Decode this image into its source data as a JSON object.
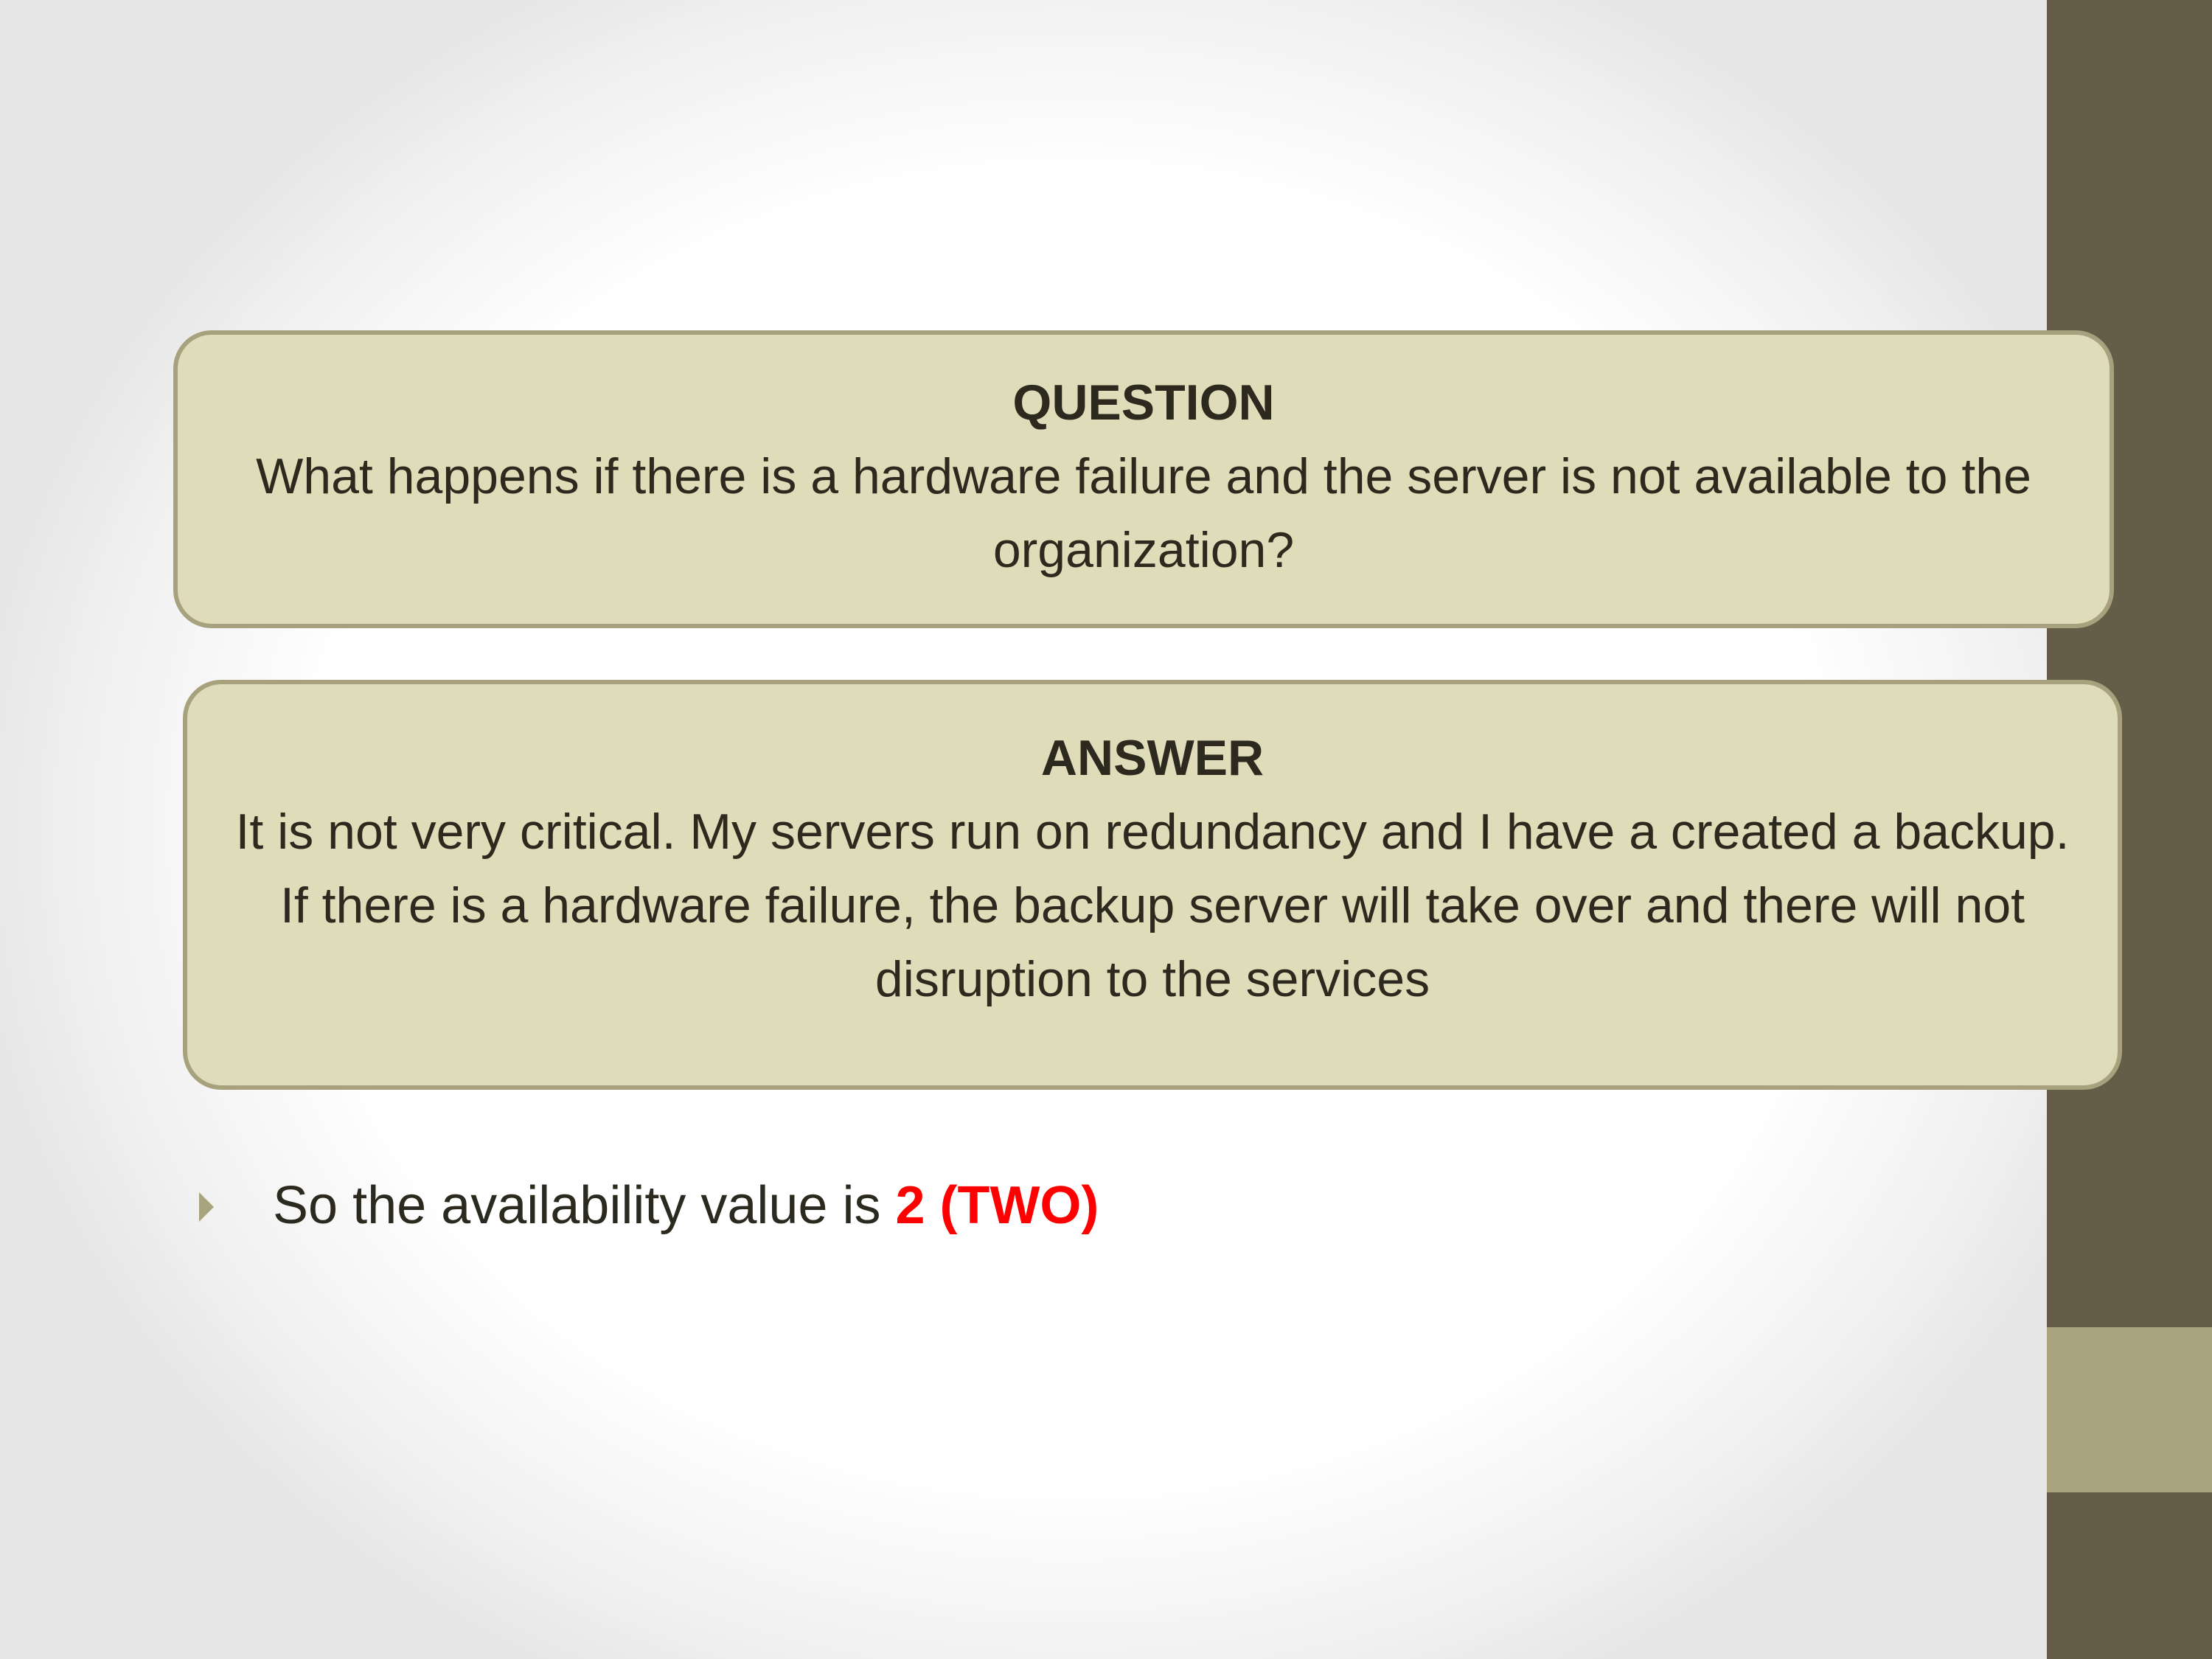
{
  "question": {
    "heading": "QUESTION",
    "text": "What happens if there is a hardware failure and the server is not available to the organization?"
  },
  "answer": {
    "heading": "ANSWER",
    "text": "It is not very critical. My servers run on redundancy and I have a created a backup. If there is a hardware failure, the backup server will take over and there will not disruption to the services"
  },
  "bullet": {
    "text": "So the availability value is",
    "highlight": "2 (TWO)",
    "highlight_color": "#ff0000"
  },
  "colors": {
    "box_fill": "#dfdcb9",
    "box_border": "#a7a27d",
    "side_bar": "#655d47",
    "side_accent": "#a9a47d",
    "text": "#2c2a1e"
  }
}
